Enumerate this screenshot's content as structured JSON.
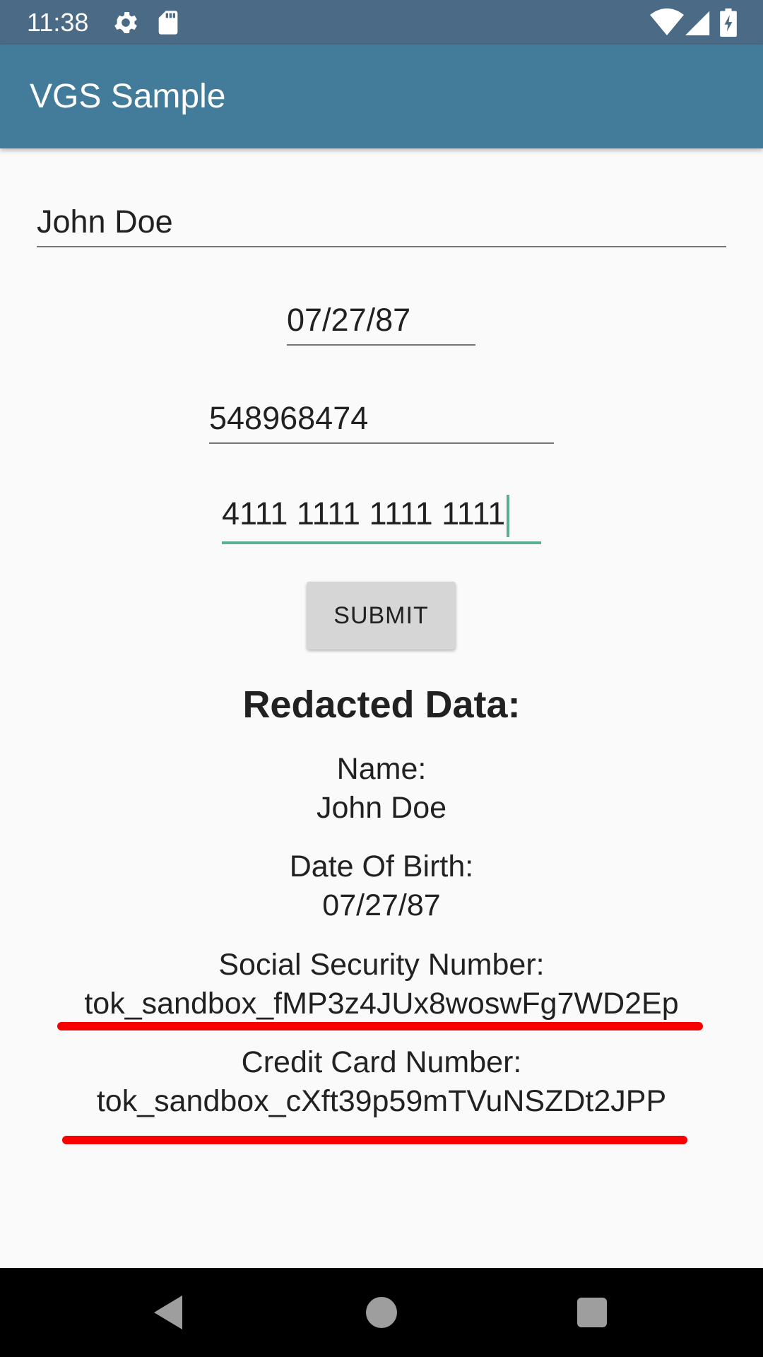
{
  "status_bar": {
    "time": "11:38",
    "icons": [
      "gear-icon",
      "sd-card-icon",
      "wifi-icon",
      "signal-icon",
      "battery-icon"
    ]
  },
  "app_bar": {
    "title": "VGS Sample"
  },
  "form": {
    "name_value": "John Doe",
    "dob_value": "07/27/87",
    "ssn_value": "548968474",
    "card_value": "4111 1111 1111 1111",
    "submit_label": "SUBMIT"
  },
  "redacted": {
    "heading": "Redacted Data:",
    "name_label": "Name:",
    "name_value": "John Doe",
    "dob_label": "Date Of Birth:",
    "dob_value": "07/27/87",
    "ssn_label": "Social Security Number:",
    "ssn_value": "tok_sandbox_fMP3z4JUx8woswFg7WD2Ep",
    "card_label": "Credit Card Number:",
    "card_value": "tok_sandbox_cXft39p59mTVuNSZDt2JPP"
  },
  "colors": {
    "status_bar": "#4a6a85",
    "app_bar": "#437c9a",
    "focus_accent": "#5fae8f",
    "annotation_red": "#f80000"
  },
  "nav_bar": {
    "icons": [
      "back-icon",
      "home-icon",
      "recents-icon"
    ]
  }
}
